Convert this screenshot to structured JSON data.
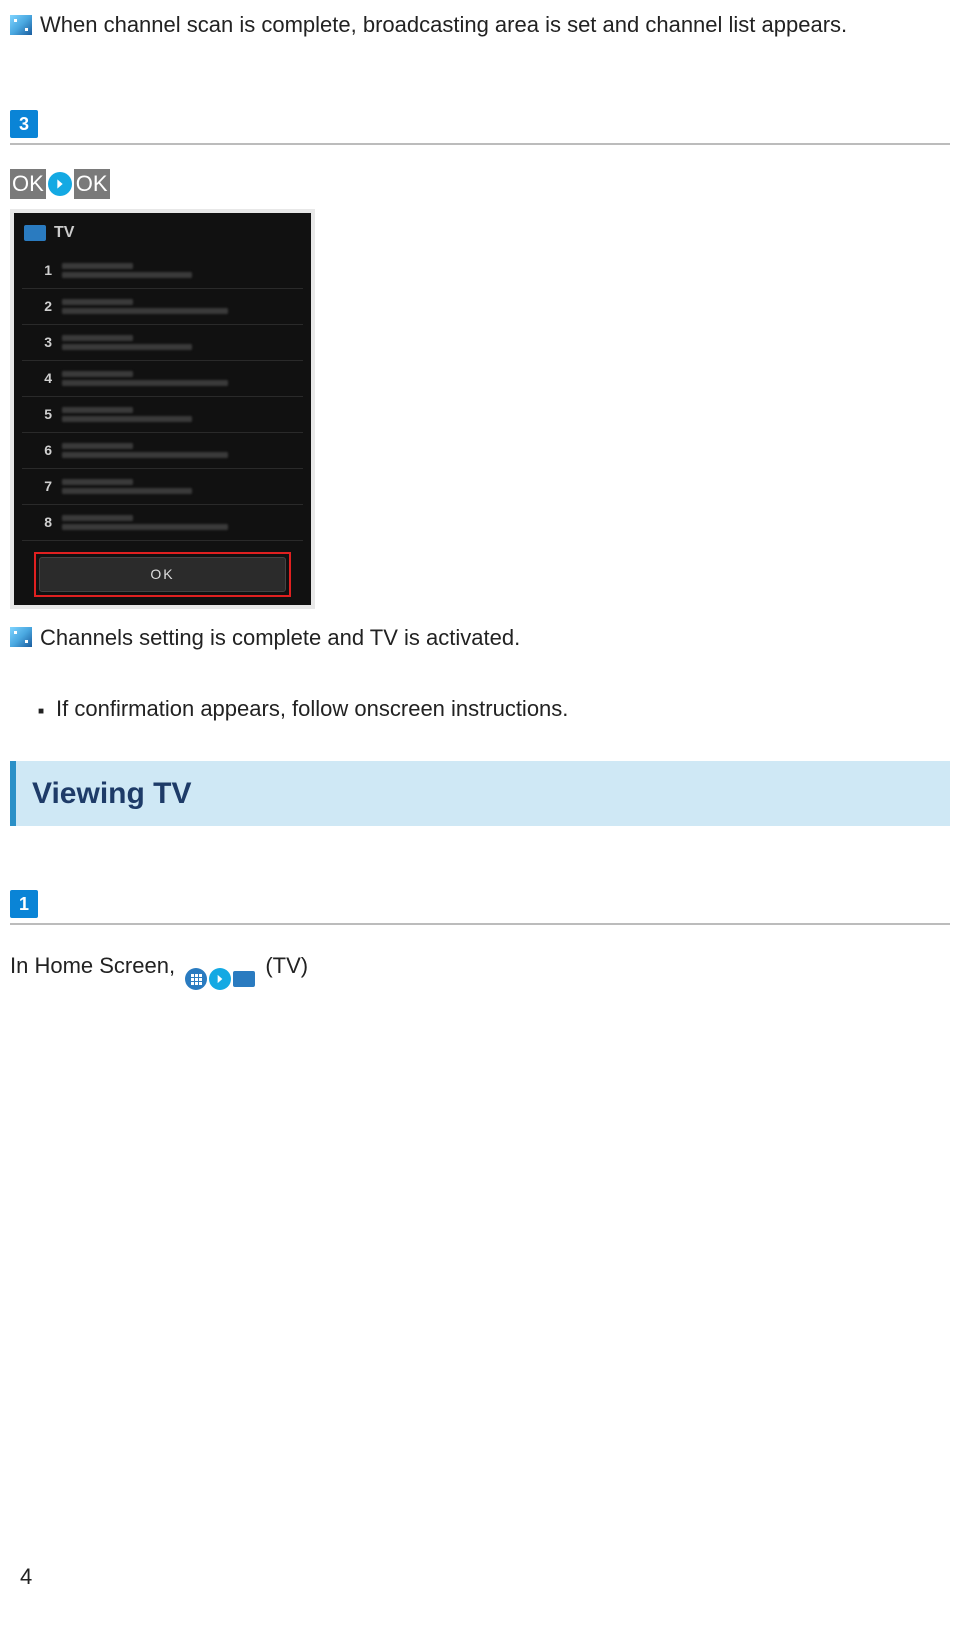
{
  "scan_complete_text": "When channel scan is complete, broadcasting area is set and channel list appears.",
  "step3": {
    "number": "3",
    "ok1": "OK",
    "ok2": "OK",
    "phone": {
      "title": "TV",
      "channels": [
        "1",
        "2",
        "3",
        "4",
        "5",
        "6",
        "7",
        "8"
      ],
      "ok_button": "OK"
    },
    "result_text": "Channels setting is complete and TV is activated.",
    "bullet": "If confirmation appears, follow onscreen instructions."
  },
  "section_heading": "Viewing TV",
  "step1": {
    "number": "1",
    "prefix": "In Home Screen, ",
    "suffix": " (TV)"
  },
  "page_number": "4"
}
